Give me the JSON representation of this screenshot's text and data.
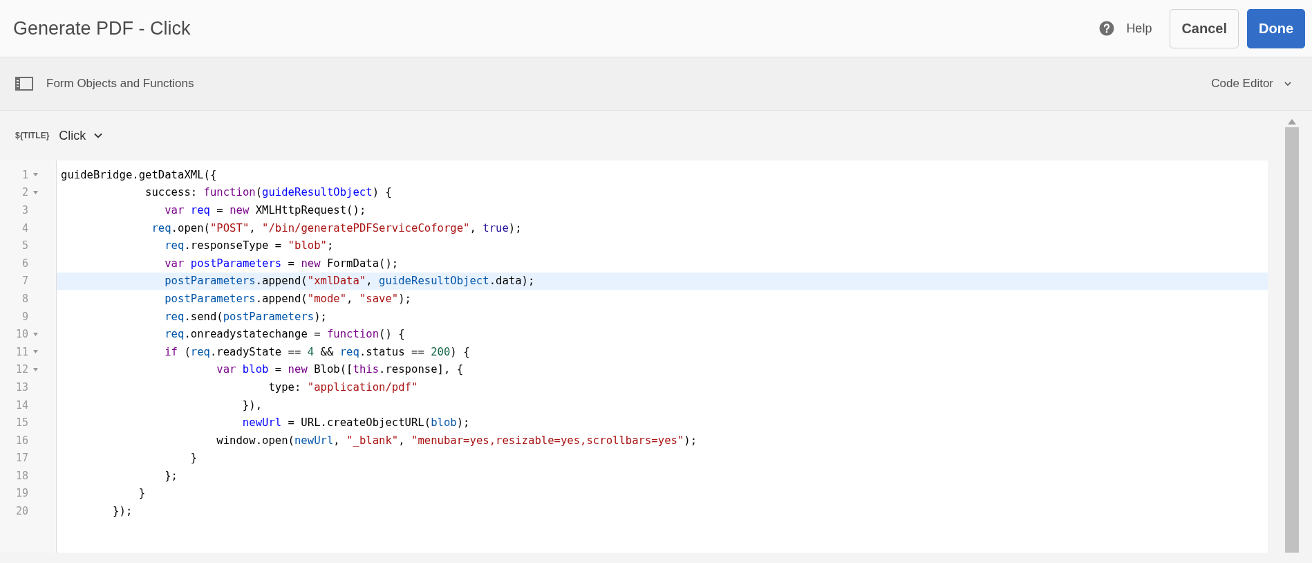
{
  "header": {
    "title": "Generate PDF - Click",
    "help": "Help",
    "buttons": [
      {
        "label": "Cancel",
        "kind": "secondary"
      },
      {
        "label": "Done",
        "kind": "primary"
      }
    ]
  },
  "toolbar": {
    "panel_label": "Form Objects and Functions",
    "mode": "Code Editor"
  },
  "event": {
    "prefix": "${TITLE}",
    "name": "Click"
  },
  "code": {
    "lines": [
      {
        "number": "1",
        "foldable": true,
        "active": false,
        "tokens": [
          {
            "kind": "plain",
            "text": "guideBridge.getDataXML({"
          }
        ]
      },
      {
        "number": "2",
        "foldable": true,
        "active": false,
        "tokens": [
          {
            "kind": "plain",
            "text": "             success: "
          },
          {
            "kind": "keyword",
            "text": "function"
          },
          {
            "kind": "plain",
            "text": "("
          },
          {
            "kind": "def",
            "text": "guideResultObject"
          },
          {
            "kind": "plain",
            "text": ") {"
          }
        ]
      },
      {
        "number": "3",
        "foldable": false,
        "active": false,
        "tokens": [
          {
            "kind": "keyword",
            "text": "                var"
          },
          {
            "kind": "def",
            "text": " req"
          },
          {
            "kind": "plain",
            "text": " = "
          },
          {
            "kind": "keyword",
            "text": "new"
          },
          {
            "kind": "plain",
            "text": " XMLHttpRequest();"
          }
        ]
      },
      {
        "number": "4",
        "foldable": false,
        "active": false,
        "tokens": [
          {
            "kind": "var",
            "text": "              req"
          },
          {
            "kind": "plain",
            "text": ".open("
          },
          {
            "kind": "string",
            "text": "\"POST\""
          },
          {
            "kind": "plain",
            "text": ", "
          },
          {
            "kind": "string",
            "text": "\"/bin/generatePDFServiceCoforge\""
          },
          {
            "kind": "plain",
            "text": ", "
          },
          {
            "kind": "atom",
            "text": "true"
          },
          {
            "kind": "plain",
            "text": ");"
          }
        ]
      },
      {
        "number": "5",
        "foldable": false,
        "active": false,
        "tokens": [
          {
            "kind": "var",
            "text": "                req"
          },
          {
            "kind": "plain",
            "text": ".responseType = "
          },
          {
            "kind": "string",
            "text": "\"blob\""
          },
          {
            "kind": "plain",
            "text": ";"
          }
        ]
      },
      {
        "number": "6",
        "foldable": false,
        "active": false,
        "tokens": [
          {
            "kind": "keyword",
            "text": "                var"
          },
          {
            "kind": "def",
            "text": " postParameters"
          },
          {
            "kind": "plain",
            "text": " = "
          },
          {
            "kind": "keyword",
            "text": "new"
          },
          {
            "kind": "plain",
            "text": " FormData();"
          }
        ]
      },
      {
        "number": "7",
        "foldable": false,
        "active": true,
        "tokens": [
          {
            "kind": "var",
            "text": "                postParameters"
          },
          {
            "kind": "plain",
            "text": ".append("
          },
          {
            "kind": "string",
            "text": "\"xmlData\""
          },
          {
            "kind": "plain",
            "text": ", "
          },
          {
            "kind": "var",
            "text": "guideResultObject"
          },
          {
            "kind": "plain",
            "text": ".data);"
          }
        ]
      },
      {
        "number": "8",
        "foldable": false,
        "active": false,
        "tokens": [
          {
            "kind": "var",
            "text": "                postParameters"
          },
          {
            "kind": "plain",
            "text": ".append("
          },
          {
            "kind": "string",
            "text": "\"mode\""
          },
          {
            "kind": "plain",
            "text": ", "
          },
          {
            "kind": "string",
            "text": "\"save\""
          },
          {
            "kind": "plain",
            "text": ");"
          }
        ]
      },
      {
        "number": "9",
        "foldable": false,
        "active": false,
        "tokens": [
          {
            "kind": "var",
            "text": "                req"
          },
          {
            "kind": "plain",
            "text": ".send("
          },
          {
            "kind": "var",
            "text": "postParameters"
          },
          {
            "kind": "plain",
            "text": ");"
          }
        ]
      },
      {
        "number": "10",
        "foldable": true,
        "active": false,
        "tokens": [
          {
            "kind": "var",
            "text": "                req"
          },
          {
            "kind": "plain",
            "text": ".onreadystatechange = "
          },
          {
            "kind": "keyword",
            "text": "function"
          },
          {
            "kind": "plain",
            "text": "() {"
          }
        ]
      },
      {
        "number": "11",
        "foldable": true,
        "active": false,
        "tokens": [
          {
            "kind": "keyword",
            "text": "                if"
          },
          {
            "kind": "plain",
            "text": " ("
          },
          {
            "kind": "var",
            "text": "req"
          },
          {
            "kind": "plain",
            "text": ".readyState == "
          },
          {
            "kind": "number",
            "text": "4"
          },
          {
            "kind": "plain",
            "text": " && "
          },
          {
            "kind": "var",
            "text": "req"
          },
          {
            "kind": "plain",
            "text": ".status == "
          },
          {
            "kind": "number",
            "text": "200"
          },
          {
            "kind": "plain",
            "text": ") {"
          }
        ]
      },
      {
        "number": "12",
        "foldable": true,
        "active": false,
        "tokens": [
          {
            "kind": "keyword",
            "text": "                        var"
          },
          {
            "kind": "def",
            "text": " blob"
          },
          {
            "kind": "plain",
            "text": " = "
          },
          {
            "kind": "keyword",
            "text": "new"
          },
          {
            "kind": "plain",
            "text": " Blob(["
          },
          {
            "kind": "keyword",
            "text": "this"
          },
          {
            "kind": "plain",
            "text": ".response], {"
          }
        ]
      },
      {
        "number": "13",
        "foldable": false,
        "active": false,
        "tokens": [
          {
            "kind": "plain",
            "text": "                                type: "
          },
          {
            "kind": "string",
            "text": "\"application/pdf\""
          }
        ]
      },
      {
        "number": "14",
        "foldable": false,
        "active": false,
        "tokens": [
          {
            "kind": "plain",
            "text": "                            }),"
          }
        ]
      },
      {
        "number": "15",
        "foldable": false,
        "active": false,
        "tokens": [
          {
            "kind": "def",
            "text": "                            newUrl"
          },
          {
            "kind": "plain",
            "text": " = URL.createObjectURL("
          },
          {
            "kind": "var",
            "text": "blob"
          },
          {
            "kind": "plain",
            "text": ");"
          }
        ]
      },
      {
        "number": "16",
        "foldable": false,
        "active": false,
        "tokens": [
          {
            "kind": "plain",
            "text": "                        window.open("
          },
          {
            "kind": "var",
            "text": "newUrl"
          },
          {
            "kind": "plain",
            "text": ", "
          },
          {
            "kind": "string",
            "text": "\"_blank\""
          },
          {
            "kind": "plain",
            "text": ", "
          },
          {
            "kind": "string",
            "text": "\"menubar=yes,resizable=yes,scrollbars=yes\""
          },
          {
            "kind": "plain",
            "text": ");"
          }
        ]
      },
      {
        "number": "17",
        "foldable": false,
        "active": false,
        "tokens": [
          {
            "kind": "plain",
            "text": "                    }"
          }
        ]
      },
      {
        "number": "18",
        "foldable": false,
        "active": false,
        "tokens": [
          {
            "kind": "plain",
            "text": "                };"
          }
        ]
      },
      {
        "number": "19",
        "foldable": false,
        "active": false,
        "tokens": [
          {
            "kind": "plain",
            "text": "            }"
          }
        ]
      },
      {
        "number": "20",
        "foldable": false,
        "active": false,
        "tokens": [
          {
            "kind": "plain",
            "text": "        });"
          }
        ]
      }
    ]
  }
}
